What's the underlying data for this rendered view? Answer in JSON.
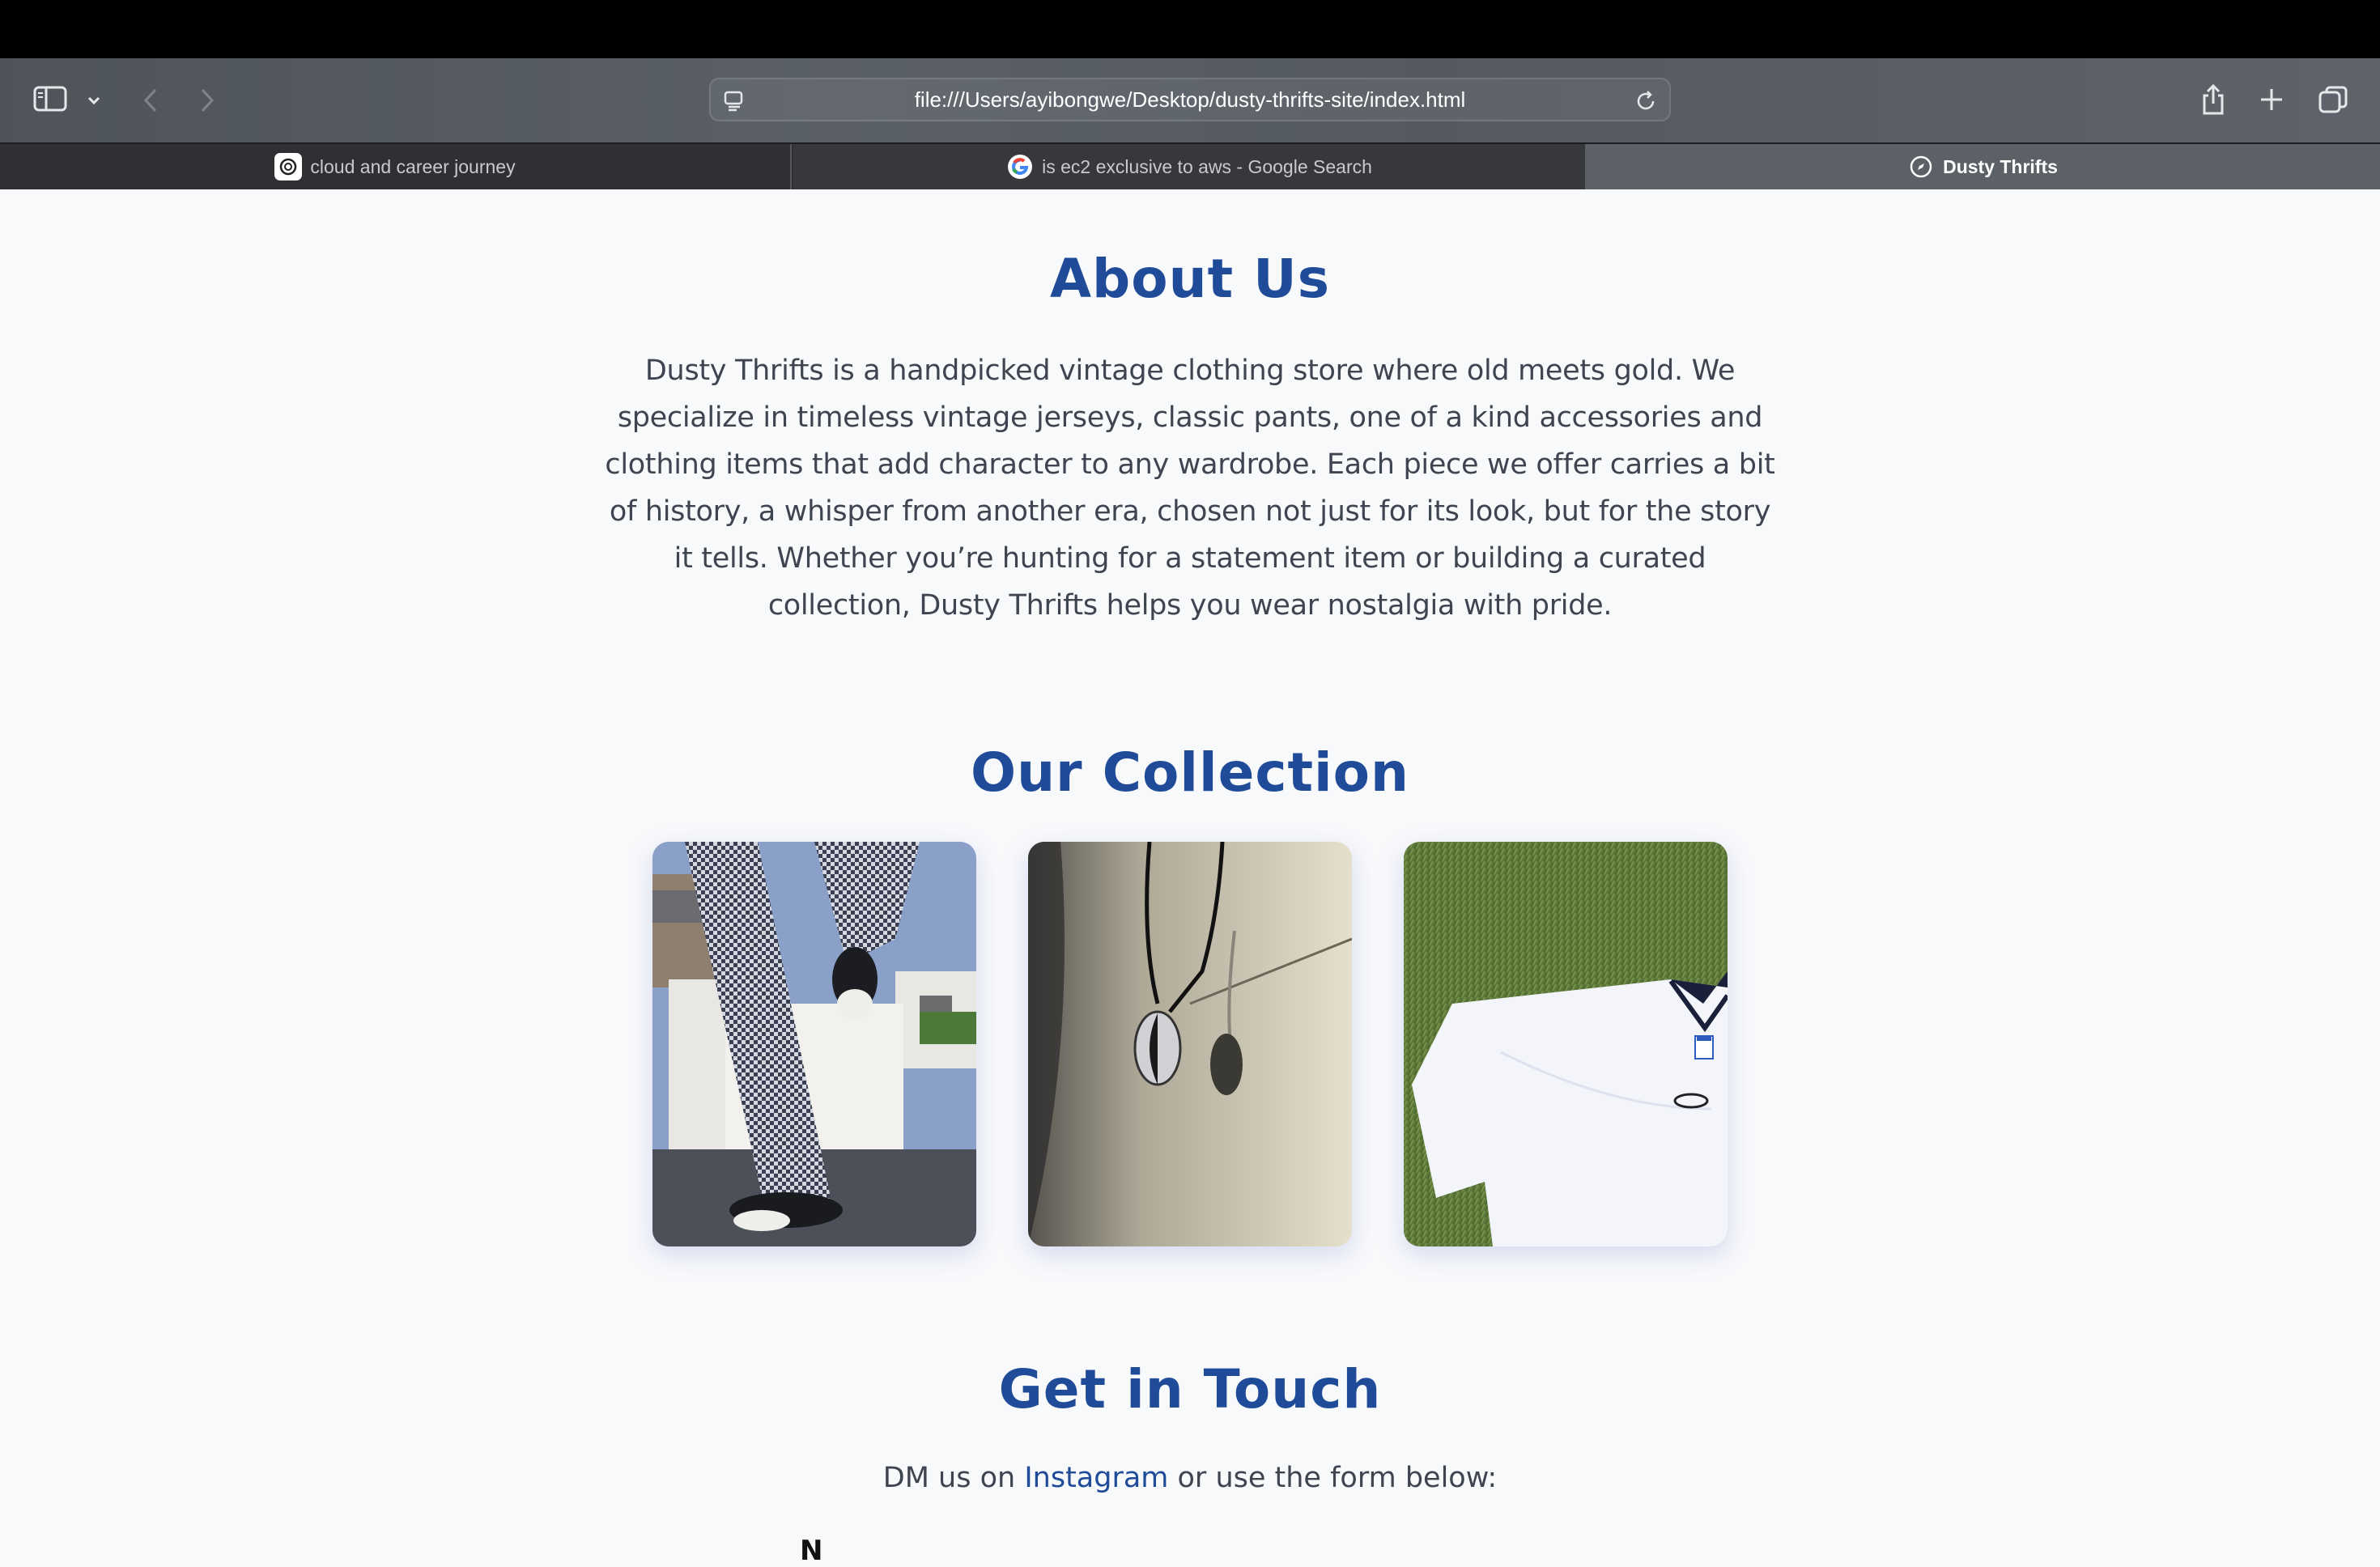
{
  "browser": {
    "url": "file:///Users/ayibongwe/Desktop/dusty-thrifts-site/index.html",
    "tabs": [
      {
        "title": "cloud and career journey",
        "icon": "openai-icon",
        "active": false
      },
      {
        "title": "is ec2 exclusive to aws - Google Search",
        "icon": "google-icon",
        "active": false
      },
      {
        "title": "Dusty Thrifts",
        "icon": "compass-icon",
        "active": true
      }
    ]
  },
  "page": {
    "about": {
      "title": "About Us",
      "text": "Dusty Thrifts is a handpicked vintage clothing store where old meets gold. We specialize in timeless vintage jerseys, classic pants, one of a kind accessories and clothing items that add character to any wardrobe. Each piece we offer carries a bit of history, a whisper from another era, chosen not just for its look, but for the story it tells. Whether you’re hunting for a statement item or building a curated collection, Dusty Thrifts helps you wear nostalgia with pride."
    },
    "collection": {
      "title": "Our Collection",
      "items": [
        {
          "image": "checkered-pants-converse-photo"
        },
        {
          "image": "yin-yang-necklace-photo"
        },
        {
          "image": "white-jersey-on-grass-photo"
        }
      ]
    },
    "contact": {
      "title": "Get in Touch",
      "text_before": "DM us on ",
      "link": "Instagram",
      "text_after": " or use the form below:",
      "form_label_peek": "N"
    }
  },
  "colors": {
    "heading": "#1f4b99",
    "body_text": "#3f4550",
    "page_bg": "#f8f9fb",
    "toolbar_bg": "#5b6068",
    "tabbar_bg": "#2f3034"
  }
}
